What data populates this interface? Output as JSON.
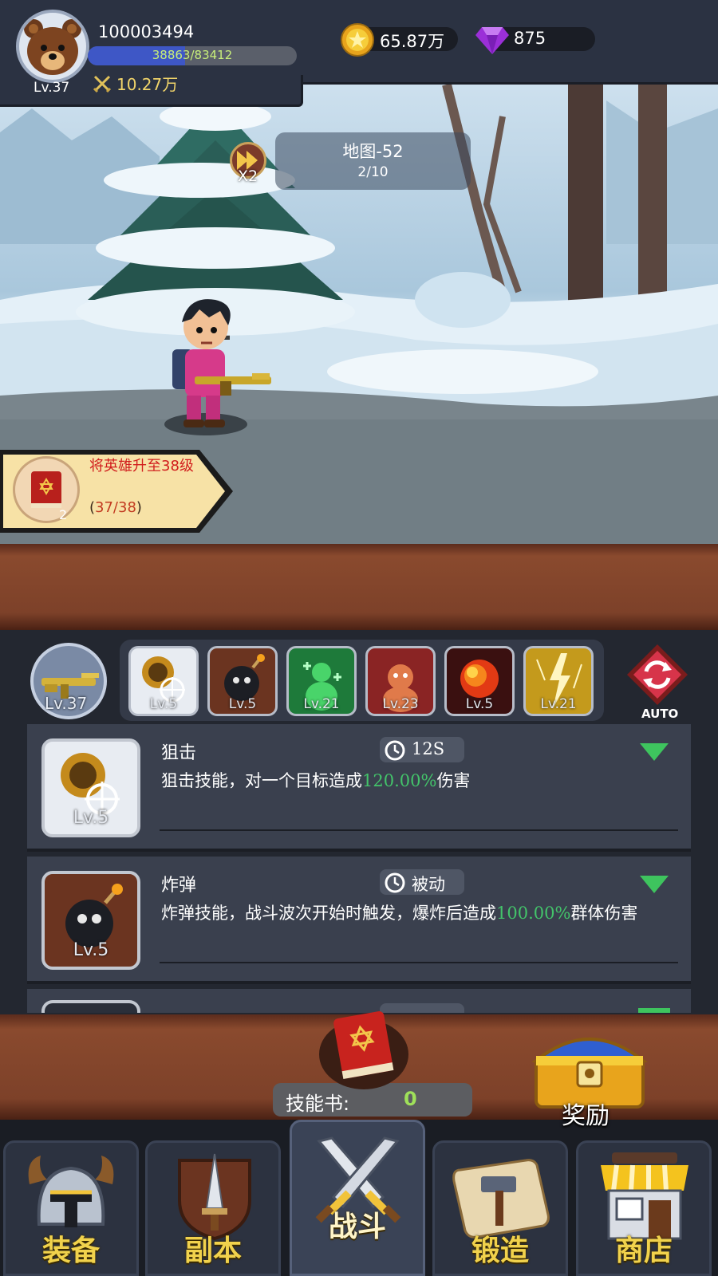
{
  "player": {
    "id": "100003494",
    "level": "Lv.37",
    "exp_text": "38863/83412",
    "exp_fraction": 0.466,
    "power": "10.27万"
  },
  "resources": {
    "gold": "65.87万",
    "gems": "875"
  },
  "stage": {
    "map_name": "地图-52",
    "wave": "2/10",
    "speed": "X2"
  },
  "quest": {
    "text": "将英雄升至38级",
    "reward_count": "2",
    "progress_open": "(",
    "progress_current": "37/38",
    "progress_close": ")"
  },
  "weapon": {
    "level": "Lv.37"
  },
  "skill_slots": [
    {
      "level": "Lv.5",
      "icon": "sniper-icon"
    },
    {
      "level": "Lv.5",
      "icon": "bomb-icon"
    },
    {
      "level": "Lv.21",
      "icon": "heal-icon"
    },
    {
      "level": "Lv.23",
      "icon": "rage-icon"
    },
    {
      "level": "Lv.5",
      "icon": "fireball-icon"
    },
    {
      "level": "Lv.21",
      "icon": "lightning-icon"
    }
  ],
  "auto_label": "AUTO",
  "skills": [
    {
      "name": "狙击",
      "cooldown": "12S",
      "level": "Lv.5",
      "desc_prefix": "狙击技能，对一个目标造成",
      "desc_value": "120.00%",
      "desc_suffix": "伤害"
    },
    {
      "name": "炸弹",
      "cooldown": "被动",
      "level": "Lv.5",
      "desc_prefix": "炸弹技能，战斗波次开始时触发，爆炸后造成",
      "desc_value": "100.00%",
      "desc_suffix": "群体伤害"
    }
  ],
  "skillbook": {
    "label": "技能书:",
    "count": "0"
  },
  "reward_label": "奖励",
  "nav": [
    {
      "label": "装备",
      "icon": "helmet-icon"
    },
    {
      "label": "副本",
      "icon": "sword-shield-icon"
    },
    {
      "label": "战斗",
      "icon": "crossed-swords-icon"
    },
    {
      "label": "锻造",
      "icon": "hammer-scroll-icon"
    },
    {
      "label": "商店",
      "icon": "shop-icon"
    }
  ],
  "colors": {
    "highlight_green": "#43c46a",
    "quest_red": "#d11d1d",
    "nav_gold": "#f1d24c",
    "exp_blue": "#3e57c6"
  }
}
